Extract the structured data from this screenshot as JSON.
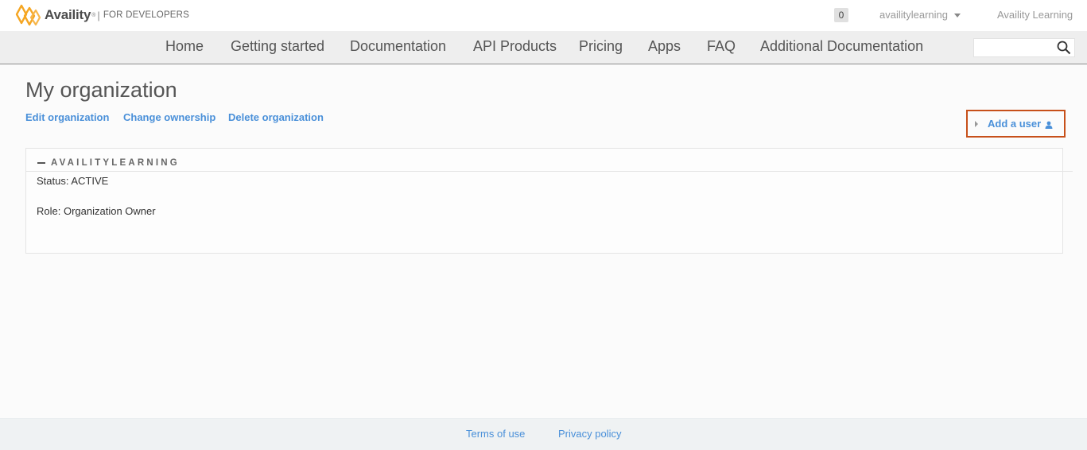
{
  "header": {
    "brand": "Availity",
    "brand_tm": "®",
    "separator": "|",
    "subtitle": "FOR DEVELOPERS",
    "cart_count": "0",
    "username": "availitylearning",
    "site_name": "Availity Learning"
  },
  "nav": {
    "items": [
      {
        "label": "Home"
      },
      {
        "label": "Getting started"
      },
      {
        "label": "Documentation"
      },
      {
        "label": "API Products"
      },
      {
        "label": "Pricing"
      },
      {
        "label": "Apps"
      },
      {
        "label": "FAQ"
      },
      {
        "label": "Additional Documentation"
      }
    ],
    "search_value": ""
  },
  "page": {
    "title": "My organization",
    "actions": [
      {
        "label": "Edit organization"
      },
      {
        "label": "Change ownership"
      },
      {
        "label": "Delete organization"
      }
    ],
    "add_user_label": "Add a user"
  },
  "organization": {
    "name": "AVAILITYLEARNING",
    "status": "Status: ACTIVE",
    "role": "Role: Organization Owner"
  },
  "footer": {
    "links": [
      {
        "label": "Terms of use"
      },
      {
        "label": "Privacy policy"
      }
    ]
  },
  "colors": {
    "link": "#4a90d9",
    "highlight_border": "#c7501a",
    "logo_orange": "#f5a623"
  }
}
